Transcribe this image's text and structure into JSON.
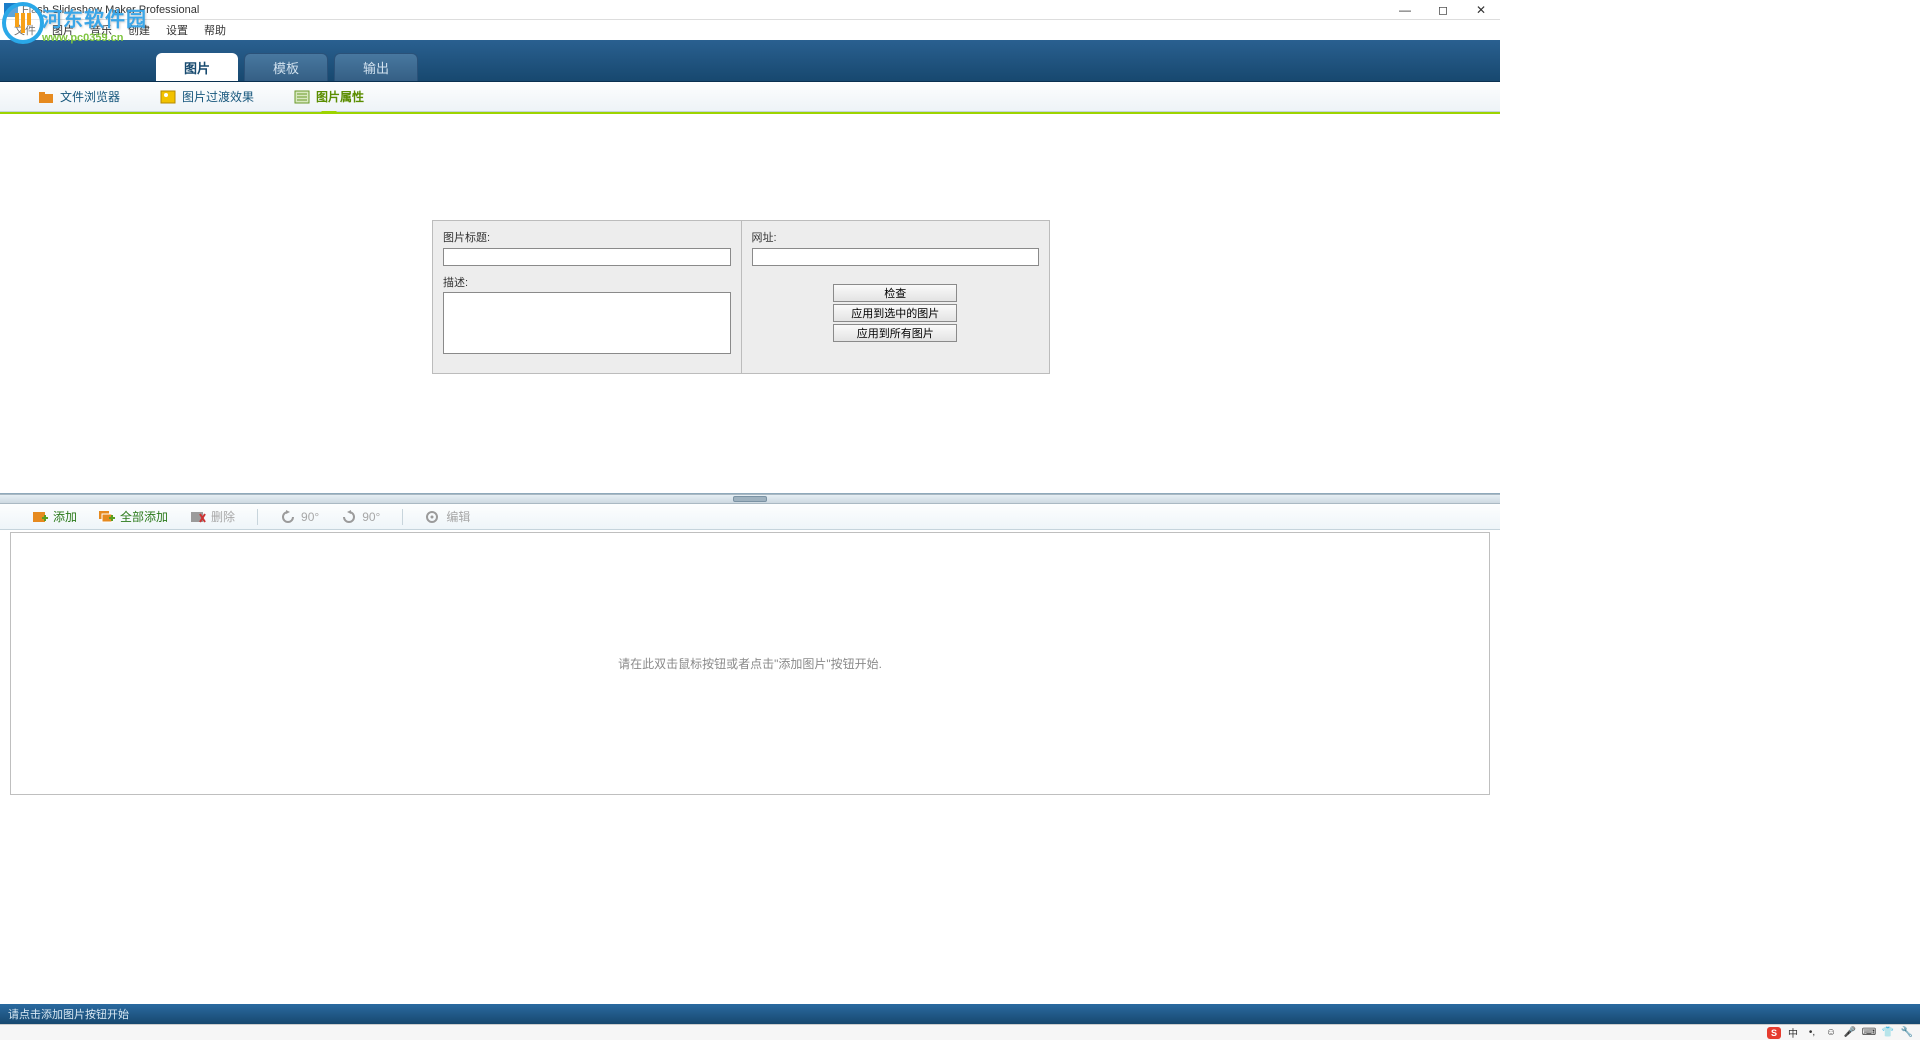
{
  "window": {
    "title": "Flash Slideshow Maker Professional"
  },
  "menu": {
    "file": "文件",
    "photo": "图片",
    "music": "音乐",
    "create": "创建",
    "settings": "设置",
    "help": "帮助"
  },
  "watermark": {
    "cn": "河东软件园",
    "url": "www.pc0359.cn"
  },
  "tabs": {
    "photo": "图片",
    "template": "模板",
    "output": "输出"
  },
  "subtabs": {
    "browser": "文件浏览器",
    "transition": "图片过渡效果",
    "properties": "图片属性"
  },
  "panel": {
    "title_label": "图片标题:",
    "title_value": "",
    "desc_label": "描述:",
    "desc_value": "",
    "url_label": "网址:",
    "url_value": "",
    "btn_check": "检查",
    "btn_apply_selected": "应用到选中的图片",
    "btn_apply_all": "应用到所有图片"
  },
  "toolbar": {
    "add": "添加",
    "add_all": "全部添加",
    "delete": "删除",
    "rotate_left": "90°",
    "rotate_right": "90°",
    "edit": "编辑"
  },
  "thumbs": {
    "hint": "请在此双击鼠标按钮或者点击\"添加图片\"按钮开始."
  },
  "status": {
    "text": "请点击添加图片按钮开始"
  },
  "tray": {
    "ime": "中"
  }
}
